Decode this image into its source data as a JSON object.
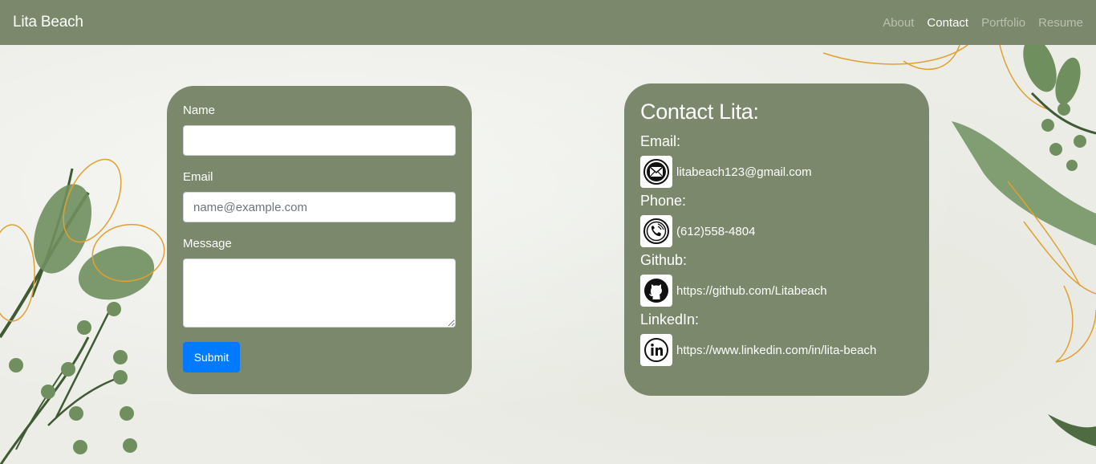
{
  "navbar": {
    "brand": "Lita Beach",
    "links": [
      {
        "label": "About"
      },
      {
        "label": "Contact"
      },
      {
        "label": "Portfolio"
      },
      {
        "label": "Resume"
      }
    ]
  },
  "form": {
    "name_label": "Name",
    "name_value": "",
    "email_label": "Email",
    "email_placeholder": "name@example.com",
    "message_label": "Message",
    "message_value": "",
    "submit_label": "Submit"
  },
  "contact": {
    "title": "Contact Lita:",
    "items": [
      {
        "heading": "Email:",
        "icon": "envelope-icon",
        "value": "litabeach123@gmail.com"
      },
      {
        "heading": "Phone:",
        "icon": "phone-icon",
        "value": "(612)558-4804"
      },
      {
        "heading": "Github:",
        "icon": "github-icon",
        "value": "https://github.com/Litabeach"
      },
      {
        "heading": "LinkedIn:",
        "icon": "linkedin-icon",
        "value": "https://www.linkedin.com/in/lita-beach"
      }
    ]
  },
  "colors": {
    "navbar": "#7b886c",
    "card": "#7b886c",
    "button": "#007bff",
    "leaf_green": "#6f8f5e",
    "leaf_outline": "#e1a030"
  }
}
